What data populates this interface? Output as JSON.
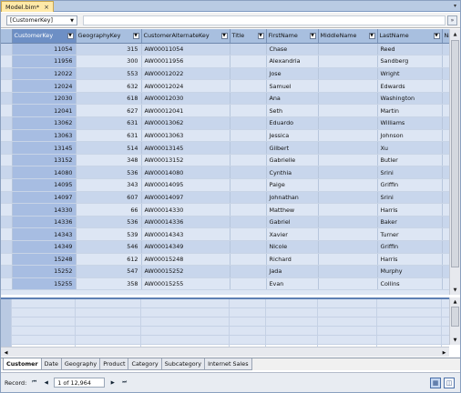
{
  "document_tab": {
    "title": "Model.bim*",
    "close": "×"
  },
  "strip_arrow": "▾",
  "measure_bar": {
    "combo_value": "[CustomerKey]",
    "expand": "»"
  },
  "columns": [
    "CustomerKey",
    "GeographyKey",
    "CustomerAlternateKey",
    "Title",
    "FirstName",
    "MiddleName",
    "LastName",
    "Nam"
  ],
  "selected_column": "CustomerKey",
  "rows": [
    [
      "11054",
      "315",
      "AW00011054",
      "",
      "Chase",
      "",
      "Reed"
    ],
    [
      "11956",
      "300",
      "AW00011956",
      "",
      "Alexandria",
      "",
      "Sandberg"
    ],
    [
      "12022",
      "553",
      "AW00012022",
      "",
      "Jose",
      "",
      "Wright"
    ],
    [
      "12024",
      "632",
      "AW00012024",
      "",
      "Samuel",
      "",
      "Edwards"
    ],
    [
      "12030",
      "618",
      "AW00012030",
      "",
      "Ana",
      "",
      "Washington"
    ],
    [
      "12041",
      "627",
      "AW00012041",
      "",
      "Seth",
      "",
      "Martin"
    ],
    [
      "13062",
      "631",
      "AW00013062",
      "",
      "Eduardo",
      "",
      "Williams"
    ],
    [
      "13063",
      "631",
      "AW00013063",
      "",
      "Jessica",
      "",
      "Johnson"
    ],
    [
      "13145",
      "514",
      "AW00013145",
      "",
      "Gilbert",
      "",
      "Xu"
    ],
    [
      "13152",
      "348",
      "AW00013152",
      "",
      "Gabrielle",
      "",
      "Butler"
    ],
    [
      "14080",
      "536",
      "AW00014080",
      "",
      "Cynthia",
      "",
      "Srini"
    ],
    [
      "14095",
      "343",
      "AW00014095",
      "",
      "Paige",
      "",
      "Griffin"
    ],
    [
      "14097",
      "607",
      "AW00014097",
      "",
      "Johnathan",
      "",
      "Srini"
    ],
    [
      "14330",
      "66",
      "AW00014330",
      "",
      "Matthew",
      "",
      "Harris"
    ],
    [
      "14336",
      "536",
      "AW00014336",
      "",
      "Gabriel",
      "",
      "Baker"
    ],
    [
      "14343",
      "539",
      "AW00014343",
      "",
      "Xavier",
      "",
      "Turner"
    ],
    [
      "14349",
      "546",
      "AW00014349",
      "",
      "Nicole",
      "",
      "Griffin"
    ],
    [
      "15248",
      "612",
      "AW00015248",
      "",
      "Richard",
      "",
      "Harris"
    ],
    [
      "15252",
      "547",
      "AW00015252",
      "",
      "Jada",
      "",
      "Murphy"
    ],
    [
      "15255",
      "358",
      "AW00015255",
      "",
      "Evan",
      "",
      "Collins"
    ]
  ],
  "sheet_tabs": [
    "Customer",
    "Date",
    "Geography",
    "Product",
    "Category",
    "Subcategory",
    "Internet Sales"
  ],
  "active_tab": "Customer",
  "status": {
    "records_label": "Record:",
    "first": "⏮",
    "prev": "◀",
    "position": "1 of 12,964",
    "next": "▶",
    "last": "⏭"
  },
  "scroll": {
    "up": "▲",
    "down": "▼",
    "left": "◀",
    "right": "▶"
  },
  "view_buttons": {
    "grid": "▦",
    "diagram": "◫"
  }
}
